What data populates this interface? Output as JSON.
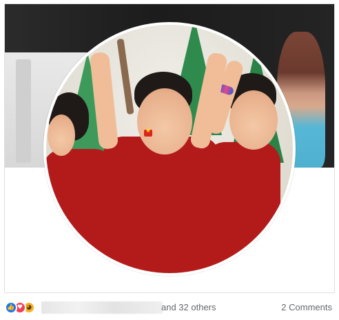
{
  "post": {
    "reactions": {
      "icons": [
        "like-icon",
        "love-icon",
        "haha-icon"
      ],
      "colors": {
        "like": "#1877f2",
        "love": "#f33e58",
        "haha": "#f7b125"
      },
      "summary_text": "and 32 others"
    },
    "comments_label": "2 Comments"
  }
}
